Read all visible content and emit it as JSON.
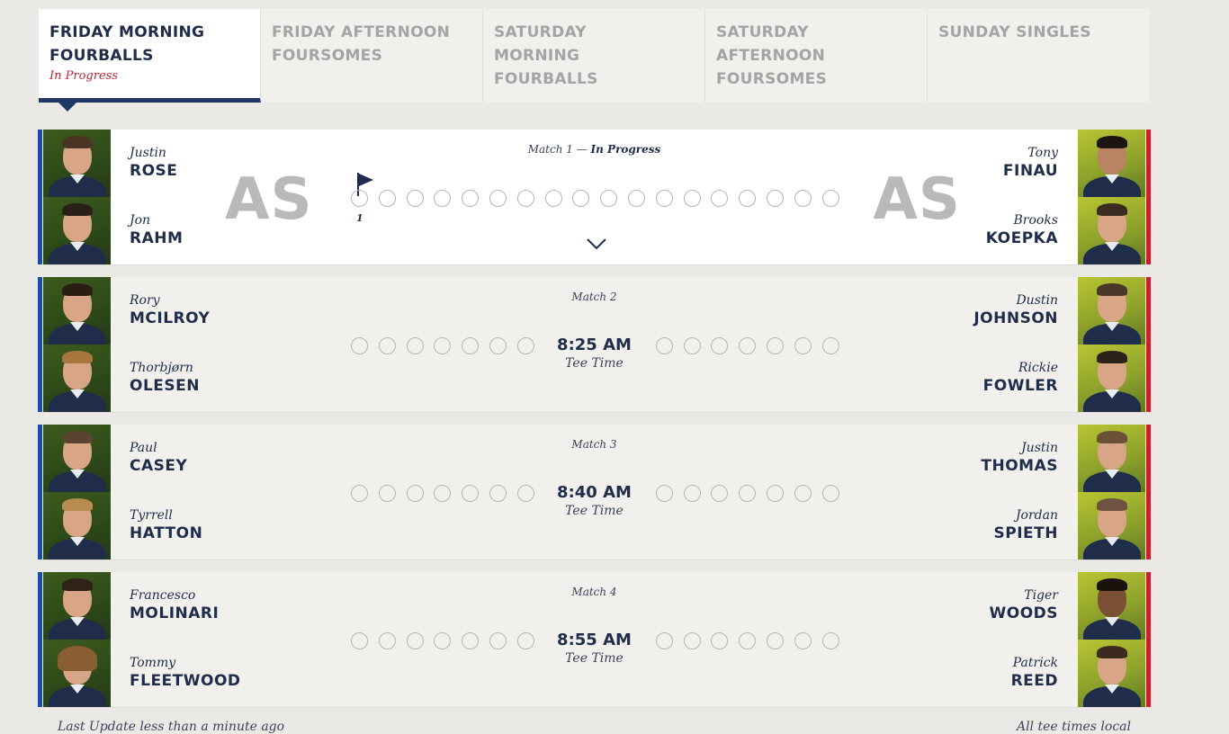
{
  "tabs": [
    {
      "label": "FRIDAY MORNING FOURBALLS",
      "status": "In Progress",
      "active": true
    },
    {
      "label": "FRIDAY AFTERNOON FOURSOMES",
      "status": "",
      "active": false
    },
    {
      "label": "SATURDAY MORNING FOURBALLS",
      "status": "",
      "active": false
    },
    {
      "label": "SATURDAY AFTERNOON FOURSOMES",
      "status": "",
      "active": false
    },
    {
      "label": "SUNDAY SINGLES",
      "status": "",
      "active": false
    }
  ],
  "colors": {
    "europe": "#1f4aa3",
    "usa": "#c8202f",
    "navy": "#1f2d4a",
    "in_progress": "#c8202f"
  },
  "matches": [
    {
      "label": "Match 1",
      "label_sep": " — ",
      "status": "In Progress",
      "left_score": "AS",
      "right_score": "AS",
      "current_hole": "1",
      "europe": [
        {
          "first": "Justin",
          "last": "ROSE"
        },
        {
          "first": "Jon",
          "last": "RAHM"
        }
      ],
      "usa": [
        {
          "first": "Tony",
          "last": "FINAU"
        },
        {
          "first": "Brooks",
          "last": "KOEPKA"
        }
      ]
    },
    {
      "label": "Match 2",
      "tee_time": "8:25 AM",
      "tee_label": "Tee Time",
      "europe": [
        {
          "first": "Rory",
          "last": "MCILROY"
        },
        {
          "first": "Thorbjørn",
          "last": "OLESEN"
        }
      ],
      "usa": [
        {
          "first": "Dustin",
          "last": "JOHNSON"
        },
        {
          "first": "Rickie",
          "last": "FOWLER"
        }
      ]
    },
    {
      "label": "Match 3",
      "tee_time": "8:40 AM",
      "tee_label": "Tee Time",
      "europe": [
        {
          "first": "Paul",
          "last": "CASEY"
        },
        {
          "first": "Tyrrell",
          "last": "HATTON"
        }
      ],
      "usa": [
        {
          "first": "Justin",
          "last": "THOMAS"
        },
        {
          "first": "Jordan",
          "last": "SPIETH"
        }
      ]
    },
    {
      "label": "Match 4",
      "tee_time": "8:55 AM",
      "tee_label": "Tee Time",
      "europe": [
        {
          "first": "Francesco",
          "last": "MOLINARI"
        },
        {
          "first": "Tommy",
          "last": "FLEETWOOD"
        }
      ],
      "usa": [
        {
          "first": "Tiger",
          "last": "WOODS"
        },
        {
          "first": "Patrick",
          "last": "REED"
        }
      ]
    }
  ],
  "footer": {
    "last_update": "Last Update less than a minute ago",
    "tee_note": "All tee times local"
  },
  "icons": {
    "flag": "flag-icon",
    "expand": "chevron-down-icon"
  }
}
